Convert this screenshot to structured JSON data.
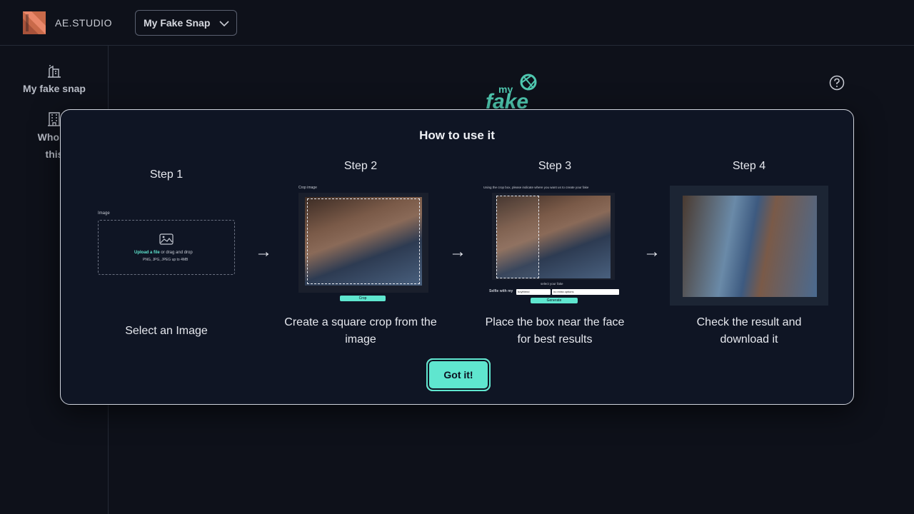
{
  "header": {
    "brand": "AE.STUDIO",
    "snap_select": "My Fake Snap"
  },
  "sidebar": {
    "items": [
      {
        "label": "My fake snap",
        "icon": "building-icon"
      },
      {
        "label_line1": "Who m",
        "label_line2": "this",
        "icon": "office-building-icon"
      }
    ]
  },
  "app_logo": {
    "text_top": "my",
    "text_bottom": "fake"
  },
  "modal": {
    "title": "How to use it",
    "steps": [
      {
        "label": "Step 1",
        "description": "Select an Image",
        "mock": {
          "field_label": "Image",
          "upload_link": "Upload a file",
          "upload_rest": " or drag and drop",
          "hint": "PNG, JPG, JPEG up to 4MB"
        }
      },
      {
        "label": "Step 2",
        "description_line1": "Create a square crop from the",
        "description_line2": "image",
        "mock": {
          "title": "Crop image",
          "button": "Crop"
        }
      },
      {
        "label": "Step 3",
        "description_line1": "Place the box near the face",
        "description_line2": "for best results",
        "mock": {
          "title": "Using the crop box, please indicate where you want us to create your fake",
          "select_label": "select your fake",
          "selfie_label": "Selfie with my",
          "option1": "boyfriend",
          "option2": "no extra options",
          "button": "Generate"
        }
      },
      {
        "label": "Step 4",
        "description_line1": "Check the result and",
        "description_line2": "download it"
      }
    ],
    "arrow": "→",
    "confirm_button": "Got it!"
  },
  "colors": {
    "accent": "#5fe6cf",
    "background": "#0e111a",
    "modal_bg": "#0f1524",
    "logo": "#e0714e"
  }
}
